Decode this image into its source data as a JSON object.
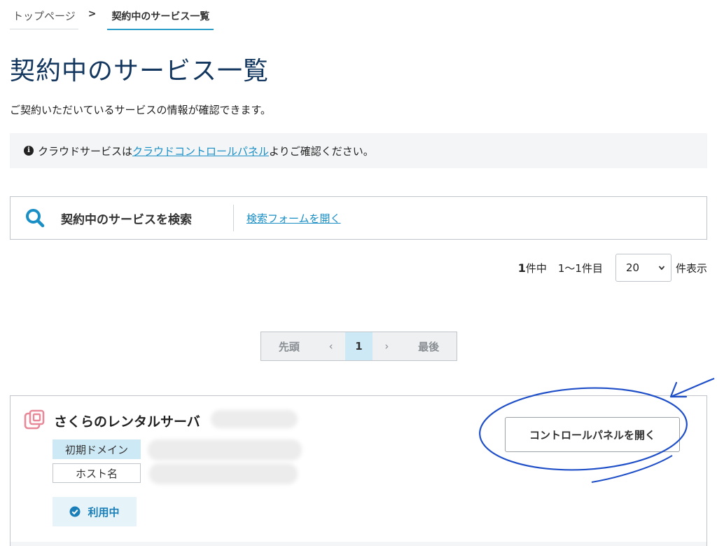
{
  "breadcrumb": {
    "home": "トップページ",
    "separator": ">",
    "current": "契約中のサービス一覧"
  },
  "page": {
    "title": "契約中のサービス一覧",
    "lead": "ご契約いただいているサービスの情報が確認できます。"
  },
  "notice": {
    "icon": "info-icon",
    "text_before": "クラウドサービスは",
    "link": "クラウドコントロールパネル",
    "text_after": "よりご確認ください。"
  },
  "search": {
    "icon": "search-icon",
    "label": "契約中のサービスを検索",
    "open_link": "検索フォームを開く"
  },
  "results": {
    "total": "1",
    "total_suffix": "件中",
    "range": "1〜1件目",
    "per_page": "20",
    "per_page_suffix": "件表示"
  },
  "pager": {
    "first": "先頭",
    "prev": "‹",
    "current": "1",
    "next": "›",
    "last": "最後"
  },
  "service_card": {
    "icon": "rental-server-icon",
    "name": "さくらのレンタルサーバ",
    "domain_label": "初期ドメイン",
    "host_label": "ホスト名",
    "status_icon": "check-circle-icon",
    "status": "利用中",
    "control_panel_button": "コントロールパネルを開く"
  },
  "colors": {
    "title": "#13375e",
    "link": "#1a8fc6",
    "accent_light": "#cde9f6",
    "annotation": "#1f4fc8",
    "icon_pink": "#e8899a"
  }
}
